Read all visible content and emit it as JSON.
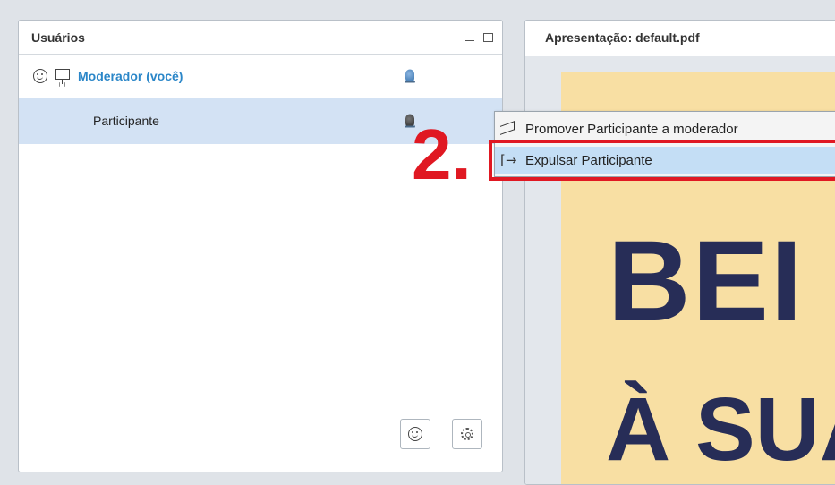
{
  "users_panel": {
    "title": "Usuários",
    "users": [
      {
        "name": "Moderador (você)",
        "role": "moderator"
      },
      {
        "name": "Participante",
        "role": "participant"
      }
    ]
  },
  "presentation_panel": {
    "title": "Apresentação: default.pdf",
    "slide_text_line1": "BEI",
    "slide_text_line2": "À SUA"
  },
  "context_menu": {
    "items": [
      {
        "label": "Promover Participante a moderador",
        "icon": "megaphone-icon"
      },
      {
        "label": "Expulsar Participante",
        "icon": "exit-icon"
      }
    ]
  },
  "annotation": {
    "step": "2."
  },
  "colors": {
    "accent_blue": "#2a86c8",
    "selected_row": "#d3e2f4",
    "menu_highlight": "#c4def5",
    "annotation_red": "#e01822",
    "slide_bg": "#f8dfa3",
    "slide_text": "#272d57"
  }
}
